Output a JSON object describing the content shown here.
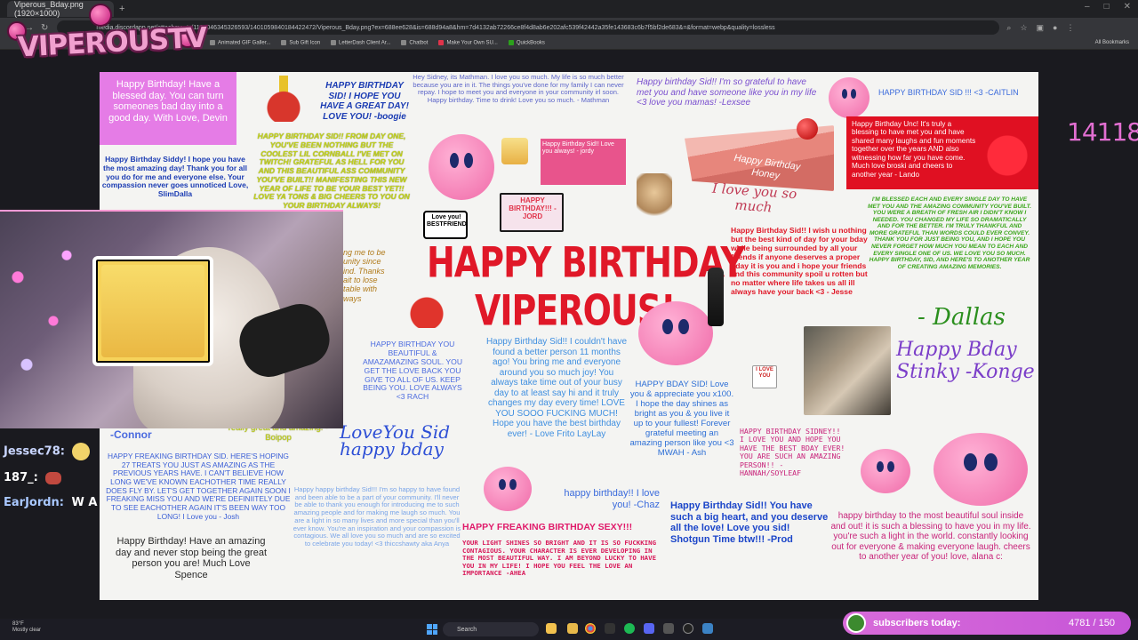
{
  "browser": {
    "tab_title": "Viperous_Bday.png (1920×1000)",
    "tab_close": "×",
    "new_tab": "+",
    "url": "media.discordapp.net/attachments/1183046345326593/1401059840184422472/Viperous_Bday.png?ex=688ee628&is=688d94a8&hm=7d4132ab72266ce8f4d8ab6e202afc539f42442a35fe143683c6b7f5bf2de683&=&format=webp&quality=lossless",
    "bookmarks": [
      "Animated GIF Galler...",
      "Sub Gift Icon",
      "LetterDash Client Ar...",
      "Chatbot",
      "Make Your Own SU...",
      "QuickBooks"
    ],
    "all_bookmarks": "All Bookmarks"
  },
  "overlay": {
    "logo_text": "VIPEROUSTV",
    "sub_count": "14118",
    "subs_label": "subscribers today:",
    "subs_value": "4781 / 150"
  },
  "chat": [
    {
      "user": "Jessec78:",
      "color": "#c9d6ff"
    },
    {
      "user": "187_:",
      "color": "#ffffff"
    },
    {
      "user": "EarJordn:",
      "text": "W A",
      "color": "#a9c8ff"
    }
  ],
  "card": {
    "title_line1": "HAPPY BIRTHDAY",
    "title_line2": "VIPEROUS!",
    "devin": "Happy Birthday! Have a blessed day. You can turn someones bad day into a good day. With Love, Devin",
    "boogie": "HAPPY BIRTHDAY SID! I HOPE YOU HAVE A GREAT DAY! LOVE YOU! -boogie",
    "slimdalla": "Happy Birthday Siddy! I hope you have the most amazing day! Thank you for all you do for me and everyone else. Your compassion never goes unnoticed Love, SlimDalla",
    "yellow_long": "HAPPY BIRTHDAY SID!! FROM DAY ONE, YOU'VE BEEN NOTHING BUT THE COOLEST LIL CORNBALL I'VE MET ON TWITCH! GRATEFUL AS HELL FOR YOU AND THIS BEAUTIFUL ASS COMMUNITY YOU'VE BUILT!! MANIFESTING THIS NEW YEAR OF LIFE TO BE YOUR BEST YET!! LOVE YA TONS & BIG CHEERS TO YOU ON YOUR BIRTHDAY ALWAYS!",
    "mathman": "Hey Sidney, its Mathman. I love you so much. My life is so much better because you are in it. The things you've done for my family I can never repay. I hope to meet you and everyone in your community irl soon. Happy birthday. Time to drink! Love you so much. - Mathman",
    "jordy_box": "Happy Birthday Sid!! Love you always! - jordy",
    "lexsee": "Happy birthday Sid!! I'm so grateful to have met you and have someone like you in my life <3 love you mamas! -Lexsee",
    "caitlin": "HAPPY BIRTHDAY SID !!! <3 -CAITLIN",
    "lando": "Happy Birthday Unc! It's truly a blessing to have met you and have shared many laughs and fun moments together over the years AND also witnessing how far you have come. Much love broski and cheers to another year - Lando",
    "dallas_long": "I'M BLESSED EACH AND EVERY SINGLE DAY TO HAVE MET YOU AND THE AMAZING COMMUNITY YOU'VE BUILT. YOU WERE A BREATH OF FRESH AIR I DIDN'T KNOW I NEEDED. YOU CHANGED MY LIFE SO DRAMATICALLY AND FOR THE BETTER. I'M TRULY THANKFUL AND MORE GRATEFUL THAN WORDS COULD EVER CONVEY. THANK YOU FOR JUST BEING YOU, AND I HOPE YOU NEVER FORGET HOW MUCH YOU MEAN TO EACH AND EVERY SINGLE ONE OF US. WE LOVE YOU SO MUCH. HAPPY BIRTHDAY, SID, AND HERE'S TO ANOTHER YEAR OF CREATING AMAZING MEMORIES.",
    "dallas_sig": "- Dallas",
    "cake_text": "Happy Birthday Honey",
    "iloveyou_script": "I love you so much",
    "jesse": "Happy Birthday Sid!! I wish u nothing but the best kind of day for your bday while being surrounded by all your friends if anyone deserves a proper bday it is you and i hope your friends and this community spoil u rotten but no matter where life takes us all ill always have your back <3 - Jesse",
    "konge": "Happy Bday Stinky -Konge",
    "partial_left": "ng me to be unity since ind. Thanks ait to lose table with ways",
    "rach": "HAPPY BIRTHDAY YOU BEAUTIFUL & AMAZAMAZING SOUL. YOU GET THE LOVE BACK YOU GIVE TO ALL OF US. KEEP BEING YOU. LOVE ALWAYS <3 RACH",
    "laylay": "Happy Birthday Sid!! I couldn't have found a better person 11 months ago! You bring me and everyone around you so much joy! You always take time out of your busy day to at least say hi and it truly changes my day every time! LOVE YOU SOOO FUCKING MUCH! Hope you have the best birthday ever! - Love Frito LayLay",
    "ash": "HAPPY BDAY SID! Love you & appreciate you x100. I hope the day shines as bright as you & you live it up to your fullest! Forever grateful meeting an amazing person like you <3 MWAH - Ash",
    "hannah": "HAPPY BIRTHDAY SIDNEY!! I LOVE YOU AND HOPE YOU HAVE THE BEST BDAY EVER! YOU ARE SUCH AN AMAZING PERSON!! - HANNAH/SOYLEAF",
    "connor": "-Connor",
    "boipop": "really great and amazing! - Boipop",
    "loveyou_script": "LoveYou Sid happy bday",
    "josh": "HAPPY FREAKING BIRTHDAY SID. HERE'S HOPING 27 TREATS YOU JUST AS AMAZING AS THE PREVIOUS YEARS HAVE. I CAN'T BELIEVE HOW LONG WE'VE KNOWN EACHOTHER TIME REALLY DOES FLY BY. LET'S GET TOGETHER AGAIN SOON I FREAKING MISS YOU AND WE'RE DEFINIITELY DUE TO SEE EACHOTHER AGAIN IT'S BEEN WAY TOO LONG! I Love you - Josh",
    "spence": "Happy Birthday! Have an amazing day and never stop being the great person you are! Much Love Spence",
    "anya": "Happy happy birthday Sid!!! I'm so happy to have found and been able to be a part of your community. I'll never be able to thank you enough for introducing me to such amazing people and for making me laugh so much. You are a light in so many lives and more special than you'll ever know. You're an inspiration and your compassion is contagious. We all love you so much and are so excited to celebrate you today! <3 thiccshawty aka Anya",
    "chaz": "happy birthday!! I love you! -Chaz",
    "prod": "Happy Birthday Sid!! You have such a big heart, and you deserve all the love! Love you sid! Shotgun Time btw!!! -Prod",
    "ahea_title": "HAPPY FREAKING BIRTHDAY SEXY!!!",
    "ahea": "YOUR LIGHT SHINES SO BRIGHT AND IT IS SO FUCKKING CONTAGIOUS. YOUR CHARACTER IS EVER DEVELOPING IN THE MOST BEAUTIFUL WAY. I AM BEYOND LUCKY TO HAVE YOU IN MY LIFE! I HOPE YOU FEEL THE LOVE AN IMPORTANCE -AHEA",
    "alana": "happy birthday to the most beautiful soul inside and out! it is such a blessing to have you in my life. you're such a light in the world. constantly looking out for everyone & making everyone laugh. cheers to another year of you! love, alana c:",
    "pixel_text": "HAPPY BIRTHDAY!!! - JORD",
    "love_badge": "Love you! BESTFRIEND",
    "ilu_badge": "I LOVE YOU"
  },
  "taskbar": {
    "weather_temp": "83°F",
    "weather_desc": "Mostly clear",
    "search": "Search"
  }
}
